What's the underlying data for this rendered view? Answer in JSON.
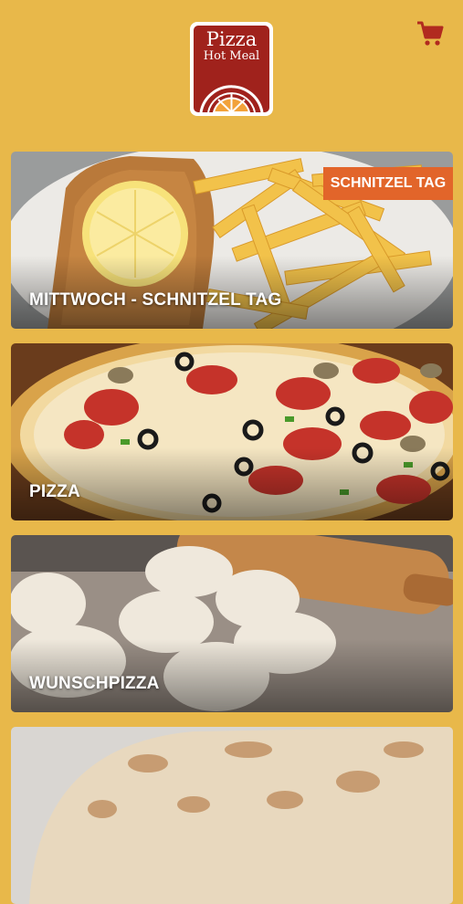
{
  "header": {
    "logo_title": "Pizza",
    "logo_subtitle": "Hot Meal",
    "cart_icon": "shopping-cart-icon",
    "colors": {
      "background": "#E8B84A",
      "brand_red": "#A0221C",
      "cart": "#B12A1F",
      "badge": "#E2652A"
    }
  },
  "categories": [
    {
      "label": "MITTWOCH - SCHNITZEL TAG",
      "badge": "SCHNITZEL TAG"
    },
    {
      "label": "PIZZA"
    },
    {
      "label": "WUNSCHPIZZA"
    },
    {
      "label": ""
    }
  ]
}
